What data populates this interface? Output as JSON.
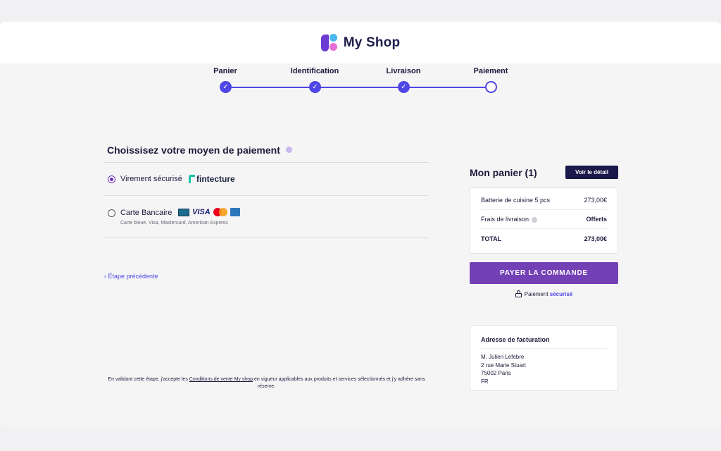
{
  "brand": {
    "name": "My Shop"
  },
  "stepper": {
    "steps": [
      {
        "label": "Panier",
        "state": "done"
      },
      {
        "label": "Identification",
        "state": "done"
      },
      {
        "label": "Livraison",
        "state": "done"
      },
      {
        "label": "Paiement",
        "state": "current"
      }
    ],
    "check_glyph": "✓"
  },
  "payment": {
    "title": "Choissisez votre moyen de paiement",
    "options": [
      {
        "label": "Virement sécurisé",
        "provider": "fintecture",
        "selected": true
      },
      {
        "label": "Carte Bancaire",
        "card_brand": "VISA",
        "sub": "Carte bleue, Visa, Mastercard, American Express",
        "selected": false
      }
    ],
    "back_label": "‹  Étape précédente"
  },
  "legal": {
    "before": "En validant cette étape, j'accepte les ",
    "link": "Conditions de vente My shop",
    "after": " en vigueur applicables aux produits et services sélectionnés et j'y adhère sans réserve."
  },
  "cart": {
    "title": "Mon panier (1)",
    "detail_button": "Voir le détail",
    "items": [
      {
        "label": "Batterie de cuisine 5 pcs",
        "value": "273,00€"
      }
    ],
    "shipping": {
      "label": "Frais de livraison",
      "value": "Offerts"
    },
    "total": {
      "label": "TOTAL",
      "value": "273,00€"
    },
    "pay_button": "PAYER LA COMMANDE",
    "secure_prefix": "Paiement",
    "secure_highlight": "sécurisé"
  },
  "billing": {
    "title": "Adresse de facturation",
    "lines": [
      "M. Julien Lefebre",
      "2 rue Marie Stuart",
      "75002 Paris",
      "FR"
    ]
  },
  "colors": {
    "accent": "#4f46e5",
    "pay": "#7340b5",
    "dark": "#1b1949"
  }
}
